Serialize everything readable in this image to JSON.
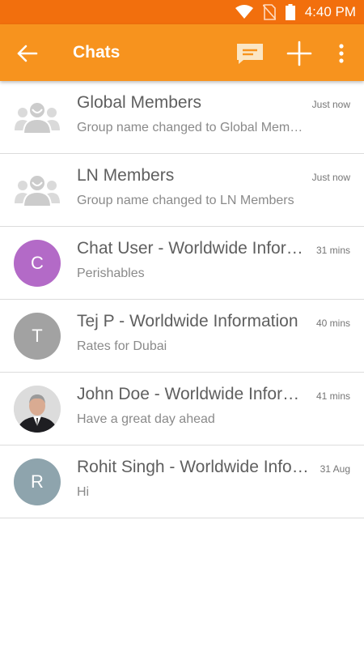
{
  "status_bar": {
    "time": "4:40 PM",
    "icons": [
      "wifi-icon",
      "no-sim-icon",
      "battery-icon"
    ]
  },
  "app_bar": {
    "title": "Chats",
    "icons": [
      "back-arrow-icon",
      "message-icon",
      "plus-icon",
      "more-vert-icon"
    ]
  },
  "colors": {
    "status_bar": "#f26f0d",
    "app_bar": "#f7931e",
    "avatar_purple": "#b36ac7",
    "avatar_grey": "#a2a2a2",
    "avatar_bluegrey": "#8ea4ad"
  },
  "chats": [
    {
      "name": "Global Members",
      "preview": "Group name changed to Global Members",
      "time": "Just now",
      "avatar_type": "group-icon"
    },
    {
      "name": "LN Members",
      "preview": "Group name changed to LN Members",
      "time": "Just now",
      "avatar_type": "group-icon"
    },
    {
      "name": "Chat User - Worldwide Information",
      "preview": "Perishables",
      "time": "31 mins",
      "avatar_letter": "C"
    },
    {
      "name": "Tej P - Worldwide Information",
      "preview": "Rates for Dubai",
      "time": "40 mins",
      "avatar_letter": "T"
    },
    {
      "name": "John Doe - Worldwide Information",
      "preview": "Have a great day ahead",
      "time": "41 mins",
      "avatar_type": "photo"
    },
    {
      "name": "Rohit Singh - Worldwide Information",
      "preview": "Hi",
      "time": "31 Aug",
      "avatar_letter": "R"
    }
  ]
}
